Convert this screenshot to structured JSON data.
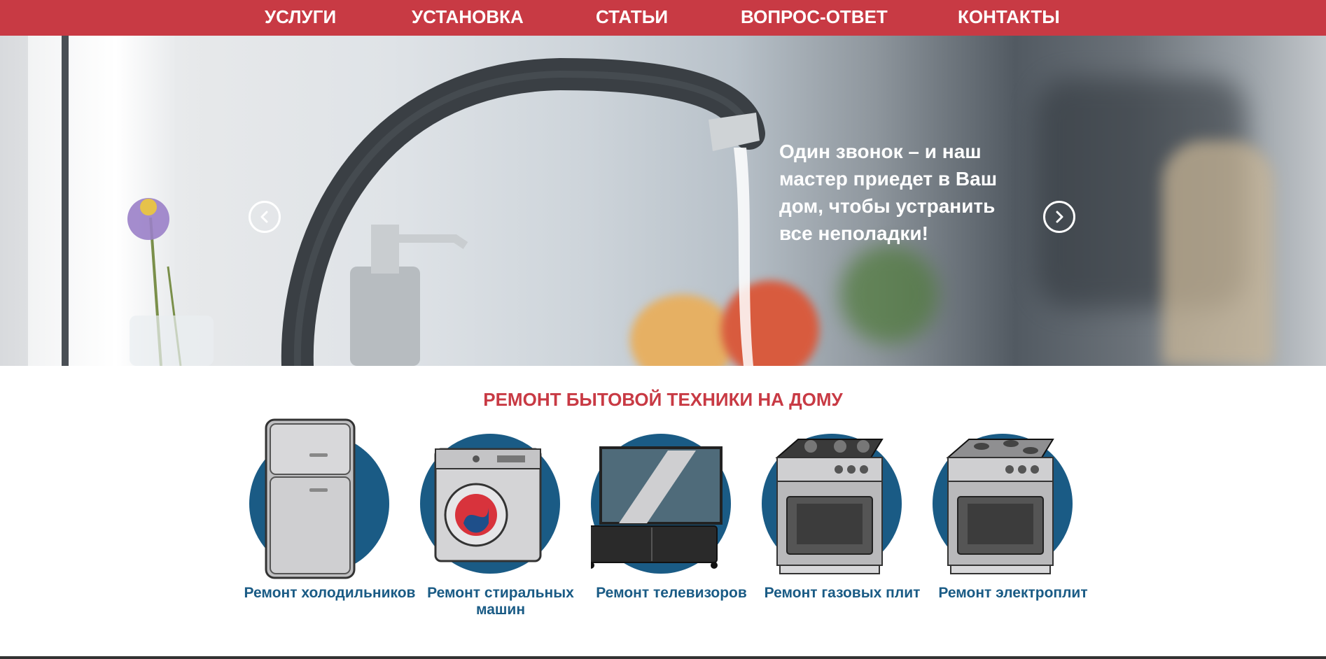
{
  "nav": {
    "items": [
      "УСЛУГИ",
      "УСТАНОВКА",
      "СТАТЬИ",
      "ВОПРОС-ОТВЕТ",
      "КОНТАКТЫ"
    ]
  },
  "hero": {
    "text": "Один звонок – и наш мастер приедет в Ваш дом, чтобы устранить все неполадки!",
    "prev_icon": "chevron-left-icon",
    "next_icon": "chevron-right-icon"
  },
  "services": {
    "title": "РЕМОНТ БЫТОВОЙ ТЕХНИКИ НА ДОМУ",
    "items": [
      {
        "label": "Ремонт холодильников",
        "icon": "refrigerator-icon"
      },
      {
        "label": "Ремонт стиральных машин",
        "icon": "washing-machine-icon"
      },
      {
        "label": "Ремонт телевизоров",
        "icon": "tv-icon"
      },
      {
        "label": "Ремонт газовых плит",
        "icon": "gas-stove-icon"
      },
      {
        "label": "Ремонт электроплит",
        "icon": "electric-stove-icon"
      }
    ]
  },
  "colors": {
    "brand_red": "#c83a44",
    "brand_blue": "#1a5b85"
  }
}
